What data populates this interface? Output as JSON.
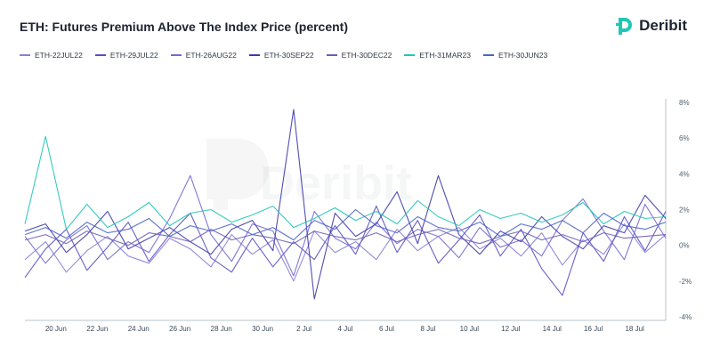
{
  "header": {
    "title": "ETH: Futures Premium Above The Index Price (percent)",
    "brand": "Deribit"
  },
  "watermark": "Deribit",
  "colors": {
    "brand_teal": "#1fc7b6",
    "axis": "#b9c4cc",
    "series": [
      "#8b7fd6",
      "#5a4fc0",
      "#7468d0",
      "#3f3aa8",
      "#6a5fb5",
      "#1fc7b6",
      "#4b63c8"
    ]
  },
  "chart_data": {
    "type": "line",
    "title": "ETH: Futures Premium Above The Index Price (percent)",
    "ylabel": "",
    "ylim": [
      -4,
      8
    ],
    "yticks": [
      -4,
      -2,
      0,
      2,
      4,
      6,
      8
    ],
    "ytick_labels": [
      "-4%",
      "-2%",
      "0%",
      "2%",
      "4%",
      "6%",
      "8%"
    ],
    "y_axis_side": "right",
    "xlim": [
      "2022-06-18T12:00",
      "2022-07-19T12:00"
    ],
    "xticks": [
      "2022-06-20",
      "2022-06-22",
      "2022-06-24",
      "2022-06-26",
      "2022-06-28",
      "2022-06-30",
      "2022-07-02",
      "2022-07-04",
      "2022-07-06",
      "2022-07-08",
      "2022-07-10",
      "2022-07-12",
      "2022-07-14",
      "2022-07-16",
      "2022-07-18"
    ],
    "xtick_labels": [
      "20 Jun",
      "22 Jun",
      "24 Jun",
      "26 Jun",
      "28 Jun",
      "30 Jun",
      "2 Jul",
      "4 Jul",
      "6 Jul",
      "8 Jul",
      "10 Jul",
      "12 Jul",
      "14 Jul",
      "16 Jul",
      "18 Jul"
    ],
    "legend_position": "top-left",
    "series": [
      {
        "name": "ETH-22JUL22",
        "color": "#8b7fd6",
        "x": [
          "2022-06-18T12:00",
          "2022-06-19T12:00",
          "2022-06-20T12:00",
          "2022-06-21T12:00",
          "2022-06-22T12:00",
          "2022-06-23T12:00",
          "2022-06-24T12:00",
          "2022-06-25T12:00",
          "2022-06-26T12:00",
          "2022-06-27T12:00",
          "2022-06-28T12:00",
          "2022-06-29T12:00",
          "2022-06-30T12:00",
          "2022-07-01T12:00",
          "2022-07-02T12:00",
          "2022-07-03T12:00",
          "2022-07-04T12:00",
          "2022-07-05T12:00",
          "2022-07-06T12:00",
          "2022-07-07T12:00",
          "2022-07-08T12:00",
          "2022-07-09T12:00",
          "2022-07-10T12:00",
          "2022-07-11T12:00",
          "2022-07-12T12:00",
          "2022-07-13T12:00",
          "2022-07-14T12:00",
          "2022-07-15T12:00",
          "2022-07-16T12:00",
          "2022-07-17T12:00",
          "2022-07-18T12:00",
          "2022-07-19T12:00"
        ],
        "y": [
          -0.8,
          0.2,
          -1.5,
          -0.3,
          0.5,
          -0.6,
          -1.0,
          0.4,
          -0.2,
          -1.2,
          0.6,
          -0.5,
          0.3,
          -2.0,
          0.8,
          -0.4,
          0.2,
          -0.8,
          0.9,
          -0.3,
          0.5,
          1.0,
          -0.2,
          0.4,
          -0.6,
          0.7,
          -1.1,
          0.3,
          -0.5,
          1.2,
          -0.4,
          0.6
        ]
      },
      {
        "name": "ETH-29JUL22",
        "color": "#5a4fc0",
        "x": [
          "2022-06-18T12:00",
          "2022-06-19T12:00",
          "2022-06-20T12:00",
          "2022-06-21T12:00",
          "2022-06-22T12:00",
          "2022-06-23T12:00",
          "2022-06-24T12:00",
          "2022-06-25T12:00",
          "2022-06-26T12:00",
          "2022-06-27T12:00",
          "2022-06-28T12:00",
          "2022-06-29T12:00",
          "2022-06-30T12:00",
          "2022-07-01T12:00",
          "2022-07-02T12:00",
          "2022-07-03T12:00",
          "2022-07-04T12:00",
          "2022-07-05T12:00",
          "2022-07-06T12:00",
          "2022-07-07T12:00",
          "2022-07-08T12:00",
          "2022-07-09T12:00",
          "2022-07-10T12:00",
          "2022-07-11T12:00",
          "2022-07-12T12:00",
          "2022-07-13T12:00",
          "2022-07-14T12:00",
          "2022-07-15T12:00",
          "2022-07-16T12:00",
          "2022-07-17T12:00",
          "2022-07-18T12:00",
          "2022-07-19T12:00"
        ],
        "y": [
          -1.8,
          -0.2,
          0.9,
          -1.4,
          -0.1,
          1.3,
          -0.9,
          0.6,
          1.8,
          -0.7,
          -1.5,
          0.4,
          -1.2,
          0.2,
          -0.8,
          1.1,
          -0.5,
          2.2,
          -0.4,
          1.4,
          -1.0,
          0.3,
          1.7,
          -0.6,
          0.9,
          -1.3,
          -2.8,
          0.7,
          -0.9,
          1.6,
          -0.3,
          1.9
        ]
      },
      {
        "name": "ETH-26AUG22",
        "color": "#7468d0",
        "x": [
          "2022-06-18T12:00",
          "2022-06-19T12:00",
          "2022-06-20T12:00",
          "2022-06-21T12:00",
          "2022-06-22T12:00",
          "2022-06-23T12:00",
          "2022-06-24T12:00",
          "2022-06-25T12:00",
          "2022-06-26T12:00",
          "2022-06-27T12:00",
          "2022-06-28T12:00",
          "2022-06-29T12:00",
          "2022-06-30T12:00",
          "2022-07-01T12:00",
          "2022-07-02T12:00",
          "2022-07-03T12:00",
          "2022-07-04T12:00",
          "2022-07-05T12:00",
          "2022-07-06T12:00",
          "2022-07-07T12:00",
          "2022-07-08T12:00",
          "2022-07-09T12:00",
          "2022-07-10T12:00",
          "2022-07-11T12:00",
          "2022-07-12T12:00",
          "2022-07-13T12:00",
          "2022-07-14T12:00",
          "2022-07-15T12:00",
          "2022-07-16T12:00",
          "2022-07-17T12:00",
          "2022-07-18T12:00",
          "2022-07-19T12:00"
        ],
        "y": [
          0.5,
          -1.0,
          0.3,
          1.1,
          -0.8,
          0.2,
          -0.4,
          1.5,
          3.9,
          0.6,
          -0.9,
          1.2,
          0.8,
          -1.7,
          1.9,
          0.4,
          -0.2,
          1.3,
          0.1,
          0.9,
          0.5,
          -0.7,
          1.0,
          -0.1,
          0.3,
          -0.6,
          1.4,
          2.6,
          0.8,
          -0.8,
          2.3,
          0.4
        ]
      },
      {
        "name": "ETH-30SEP22",
        "color": "#3f3aa8",
        "x": [
          "2022-06-18T12:00",
          "2022-06-19T12:00",
          "2022-06-20T12:00",
          "2022-06-21T12:00",
          "2022-06-22T12:00",
          "2022-06-23T12:00",
          "2022-06-24T12:00",
          "2022-06-25T12:00",
          "2022-06-26T12:00",
          "2022-06-27T12:00",
          "2022-06-28T12:00",
          "2022-06-29T12:00",
          "2022-06-30T12:00",
          "2022-07-01T12:00",
          "2022-07-02T12:00",
          "2022-07-03T12:00",
          "2022-07-04T12:00",
          "2022-07-05T12:00",
          "2022-07-06T12:00",
          "2022-07-07T12:00",
          "2022-07-08T12:00",
          "2022-07-09T12:00",
          "2022-07-10T12:00",
          "2022-07-11T12:00",
          "2022-07-12T12:00",
          "2022-07-13T12:00",
          "2022-07-14T12:00",
          "2022-07-15T12:00",
          "2022-07-16T12:00",
          "2022-07-17T12:00",
          "2022-07-18T12:00",
          "2022-07-19T12:00"
        ],
        "y": [
          0.8,
          1.2,
          -0.4,
          0.6,
          1.9,
          -0.2,
          0.4,
          1.0,
          0.2,
          -0.5,
          0.9,
          1.4,
          -0.3,
          7.6,
          -3.0,
          1.8,
          0.5,
          1.2,
          3.0,
          0.1,
          3.9,
          0.6,
          -0.5,
          0.8,
          0.2,
          1.6,
          0.5,
          -0.2,
          1.1,
          0.7,
          2.8,
          1.5
        ]
      },
      {
        "name": "ETH-30DEC22",
        "color": "#6a5fb5",
        "x": [
          "2022-06-18T12:00",
          "2022-06-19T12:00",
          "2022-06-20T12:00",
          "2022-06-21T12:00",
          "2022-06-22T12:00",
          "2022-06-23T12:00",
          "2022-06-24T12:00",
          "2022-06-25T12:00",
          "2022-06-26T12:00",
          "2022-06-27T12:00",
          "2022-06-28T12:00",
          "2022-06-29T12:00",
          "2022-06-30T12:00",
          "2022-07-01T12:00",
          "2022-07-02T12:00",
          "2022-07-03T12:00",
          "2022-07-04T12:00",
          "2022-07-05T12:00",
          "2022-07-06T12:00",
          "2022-07-07T12:00",
          "2022-07-08T12:00",
          "2022-07-09T12:00",
          "2022-07-10T12:00",
          "2022-07-11T12:00",
          "2022-07-12T12:00",
          "2022-07-13T12:00",
          "2022-07-14T12:00",
          "2022-07-15T12:00",
          "2022-07-16T12:00",
          "2022-07-17T12:00",
          "2022-07-18T12:00",
          "2022-07-19T12:00"
        ],
        "y": [
          0.3,
          0.6,
          0.1,
          0.8,
          0.4,
          0.0,
          0.7,
          0.5,
          0.2,
          0.9,
          0.3,
          0.6,
          0.4,
          0.1,
          0.8,
          0.5,
          0.3,
          0.7,
          0.2,
          0.6,
          0.9,
          0.4,
          0.1,
          0.5,
          0.8,
          0.3,
          0.6,
          0.2,
          0.7,
          0.4,
          0.5,
          0.6
        ]
      },
      {
        "name": "ETH-31MAR23",
        "color": "#1fc7b6",
        "x": [
          "2022-06-18T12:00",
          "2022-06-19T12:00",
          "2022-06-20T12:00",
          "2022-06-21T12:00",
          "2022-06-22T12:00",
          "2022-06-23T12:00",
          "2022-06-24T12:00",
          "2022-06-25T12:00",
          "2022-06-26T12:00",
          "2022-06-27T12:00",
          "2022-06-28T12:00",
          "2022-06-29T12:00",
          "2022-06-30T12:00",
          "2022-07-01T12:00",
          "2022-07-02T12:00",
          "2022-07-03T12:00",
          "2022-07-04T12:00",
          "2022-07-05T12:00",
          "2022-07-06T12:00",
          "2022-07-07T12:00",
          "2022-07-08T12:00",
          "2022-07-09T12:00",
          "2022-07-10T12:00",
          "2022-07-11T12:00",
          "2022-07-12T12:00",
          "2022-07-13T12:00",
          "2022-07-14T12:00",
          "2022-07-15T12:00",
          "2022-07-16T12:00",
          "2022-07-17T12:00",
          "2022-07-18T12:00",
          "2022-07-19T12:00"
        ],
        "y": [
          1.2,
          6.1,
          0.9,
          2.3,
          1.0,
          1.6,
          2.4,
          1.1,
          1.8,
          2.0,
          1.3,
          1.7,
          2.2,
          1.0,
          1.5,
          2.1,
          1.4,
          1.9,
          1.2,
          2.5,
          1.6,
          1.1,
          2.0,
          1.5,
          1.8,
          1.3,
          1.7,
          2.4,
          1.2,
          1.9,
          1.5,
          1.6
        ]
      },
      {
        "name": "ETH-30JUN23",
        "color": "#4b63c8",
        "x": [
          "2022-06-18T12:00",
          "2022-06-19T12:00",
          "2022-06-20T12:00",
          "2022-06-21T12:00",
          "2022-06-22T12:00",
          "2022-06-23T12:00",
          "2022-06-24T12:00",
          "2022-06-25T12:00",
          "2022-06-26T12:00",
          "2022-06-27T12:00",
          "2022-06-28T12:00",
          "2022-06-29T12:00",
          "2022-06-30T12:00",
          "2022-07-01T12:00",
          "2022-07-02T12:00",
          "2022-07-03T12:00",
          "2022-07-04T12:00",
          "2022-07-05T12:00",
          "2022-07-06T12:00",
          "2022-07-07T12:00",
          "2022-07-08T12:00",
          "2022-07-09T12:00",
          "2022-07-10T12:00",
          "2022-07-11T12:00",
          "2022-07-12T12:00",
          "2022-07-13T12:00",
          "2022-07-14T12:00",
          "2022-07-15T12:00",
          "2022-07-16T12:00",
          "2022-07-17T12:00",
          "2022-07-18T12:00",
          "2022-07-19T12:00"
        ],
        "y": [
          0.6,
          1.0,
          0.4,
          1.3,
          0.7,
          0.9,
          1.5,
          0.5,
          1.1,
          0.8,
          1.2,
          0.6,
          1.0,
          0.3,
          1.4,
          0.9,
          2.0,
          1.1,
          0.7,
          1.6,
          1.0,
          0.8,
          1.3,
          0.5,
          1.2,
          0.9,
          1.4,
          0.7,
          1.8,
          1.1,
          0.9,
          1.3
        ]
      }
    ]
  }
}
